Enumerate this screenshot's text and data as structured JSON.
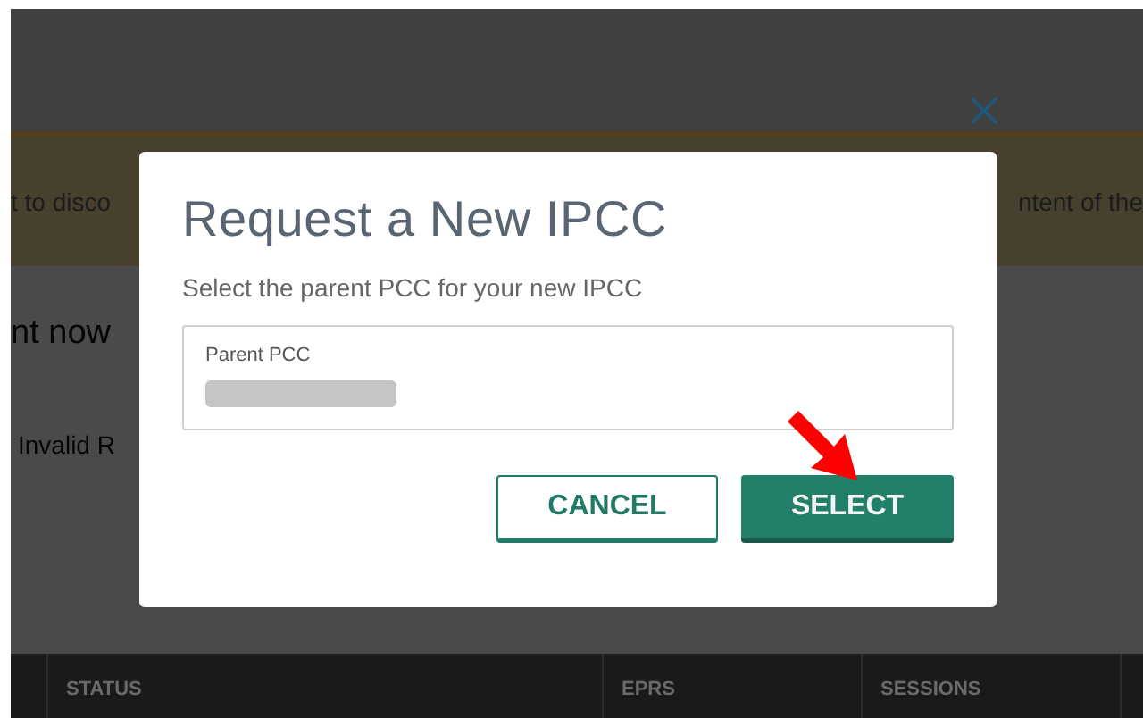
{
  "background": {
    "banner": {
      "left_text": "t to disco",
      "right_text": "ntent of the"
    },
    "heading": "nt now",
    "message": "Invalid R",
    "table": {
      "columns": [
        "STATUS",
        "EPRS",
        "SESSIONS"
      ]
    }
  },
  "dialog": {
    "title": "Request a New IPCC",
    "subtitle": "Select the parent PCC for your new IPCC",
    "field": {
      "label": "Parent PCC"
    },
    "buttons": [
      {
        "label": "CANCEL",
        "kind": "secondary"
      },
      {
        "label": "SELECT",
        "kind": "primary"
      }
    ]
  }
}
